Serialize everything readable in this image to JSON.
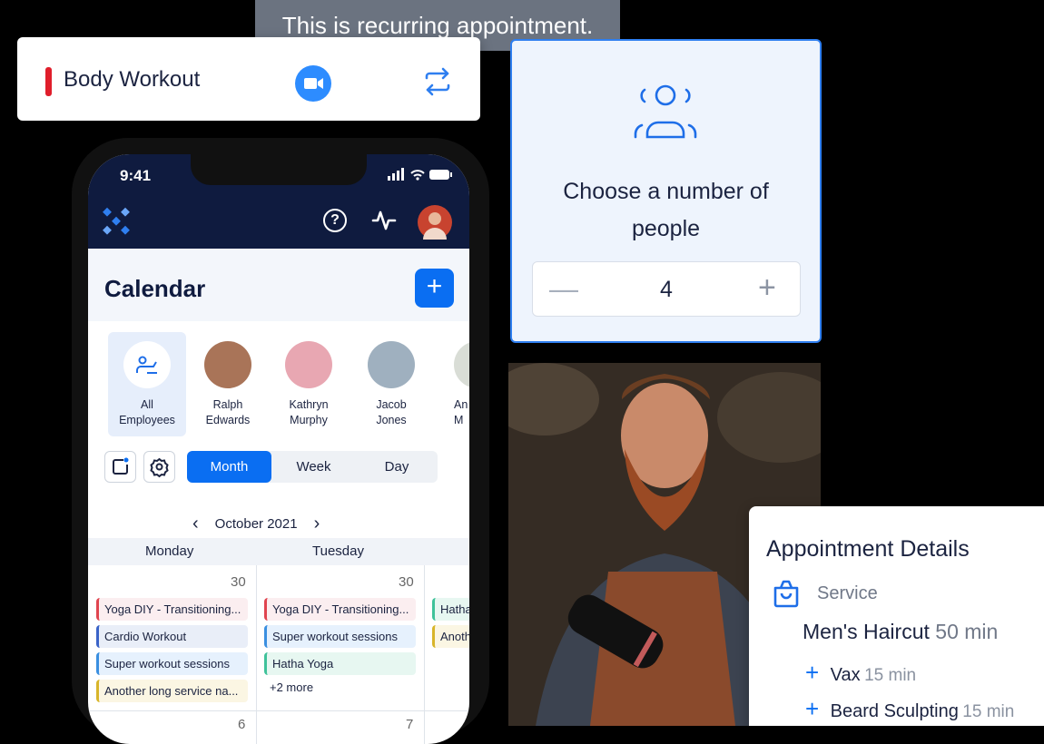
{
  "tooltip": {
    "text": "This is recurring appointment."
  },
  "event_card": {
    "title": "Body Workout",
    "color": "#e01e2b",
    "zoom_icon": "video-camera-icon",
    "recur_icon": "repeat-icon"
  },
  "phone": {
    "status": {
      "time": "9:41"
    },
    "header": {
      "logo_icon": "app-logo-icon",
      "help_icon": "help-icon",
      "activity_icon": "activity-icon"
    },
    "calendar": {
      "title": "Calendar",
      "add_label": "+",
      "employees": [
        {
          "line1": "All",
          "line2": "Employees"
        },
        {
          "line1": "Ralph",
          "line2": "Edwards"
        },
        {
          "line1": "Kathryn",
          "line2": "Murphy"
        },
        {
          "line1": "Jacob",
          "line2": "Jones"
        },
        {
          "line1": "An",
          "line2": "M"
        }
      ],
      "view_tabs": [
        "Month",
        "Week",
        "Day"
      ],
      "selected_tab": "Month",
      "month": "October 2021",
      "days": [
        "Monday",
        "Tuesday"
      ],
      "date_numbers": [
        "30",
        "30",
        "6",
        "7"
      ],
      "monday_events": [
        {
          "label": "Yoga DIY - Transitioning...",
          "color": "#e0444f",
          "bg": "#fbeef0"
        },
        {
          "label": "Cardio Workout",
          "color": "#3a63c8",
          "bg": "#e9eef8"
        },
        {
          "label": "Super workout sessions",
          "color": "#3a8fe0",
          "bg": "#e6f1fd"
        },
        {
          "label": "Another long service na...",
          "color": "#d8b52a",
          "bg": "#fbf6e3"
        }
      ],
      "tuesday_events": [
        {
          "label": "Yoga DIY - Transitioning...",
          "color": "#e0444f",
          "bg": "#fbeef0"
        },
        {
          "label": "Super workout sessions",
          "color": "#3a8fe0",
          "bg": "#e6f1fd"
        },
        {
          "label": "Hatha Yoga",
          "color": "#3fc29a",
          "bg": "#e7f7f1"
        }
      ],
      "tuesday_more": "+2 more",
      "wednesday_events": [
        {
          "label": "Hatha",
          "color": "#3fc29a",
          "bg": "#e7f7f1"
        },
        {
          "label": "Anoth",
          "color": "#d8b52a",
          "bg": "#fbf6e3"
        }
      ]
    }
  },
  "people_card": {
    "label_line1": "Choose a number of",
    "label_line2": "people",
    "value": "4",
    "minus": "—",
    "plus": "+",
    "icon": "people-group-icon"
  },
  "details": {
    "title": "Appointment Details",
    "service_label": "Service",
    "service_icon": "shopping-bag-icon",
    "service_name": "Men's Haircut",
    "service_duration": "50 min",
    "extras": [
      {
        "name": "Vax",
        "duration": "15 min"
      },
      {
        "name": "Beard Sculpting",
        "duration": "15 min"
      }
    ]
  }
}
